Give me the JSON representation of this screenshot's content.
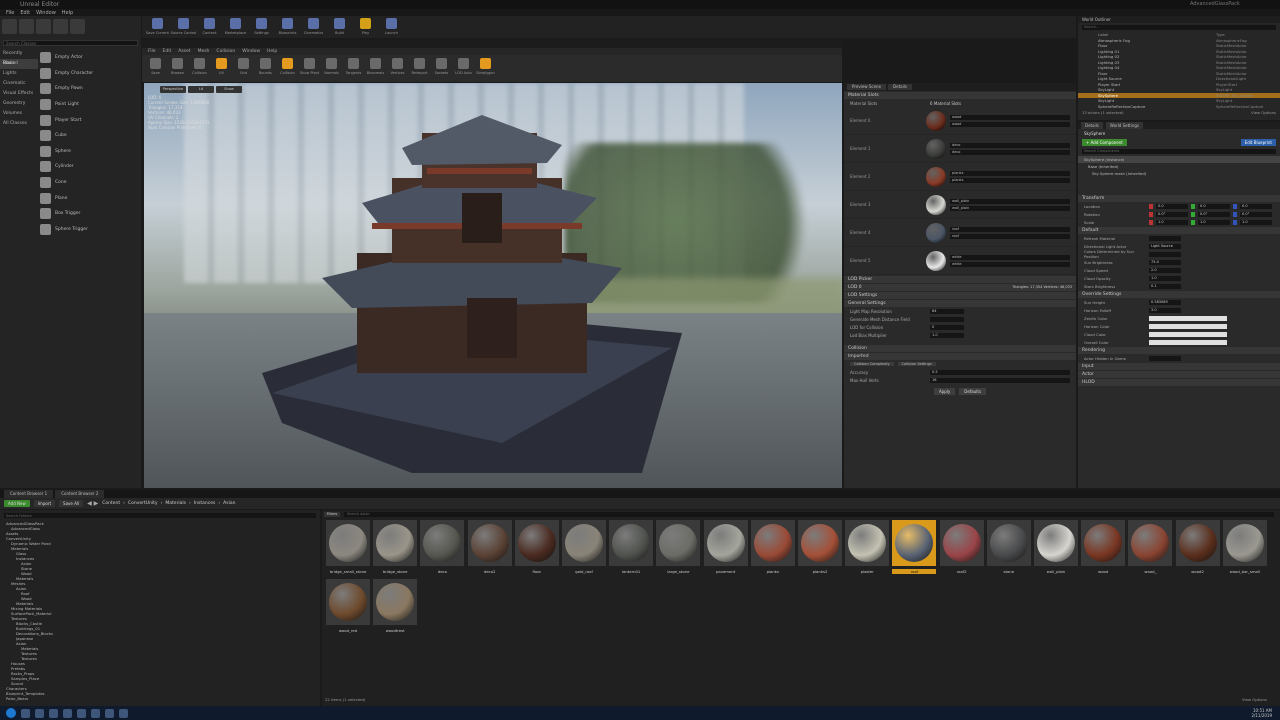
{
  "window": {
    "title": "Unreal Editor",
    "project": "AdvancedGlassPack"
  },
  "menu": [
    "File",
    "Edit",
    "Window",
    "Help"
  ],
  "main_toolbar": [
    "Save Current",
    "Source Control",
    "Content",
    "Marketplace",
    "Settings",
    "Blueprints",
    "Cinematics",
    "Build",
    "Play",
    "Launch"
  ],
  "modes": {
    "search_placeholder": "Search Classes",
    "categories": [
      "Recently Placed",
      "Basic",
      "Lights",
      "Cinematic",
      "Visual Effects",
      "Geometry",
      "Volumes",
      "All Classes"
    ],
    "selected_category": "Basic",
    "items": [
      "Empty Actor",
      "Empty Character",
      "Empty Pawn",
      "Point Light",
      "Player Start",
      "Cube",
      "Sphere",
      "Cylinder",
      "Cone",
      "Plane",
      "Box Trigger",
      "Sphere Trigger"
    ]
  },
  "viewport": {
    "menu": [
      "File",
      "Edit",
      "Asset",
      "Mesh",
      "Collision",
      "Window",
      "Help"
    ],
    "toolbar": [
      "Save",
      "Browse",
      "Collision",
      "UV",
      "Grid",
      "Bounds",
      "Collision",
      "Show Pivot",
      "Normals",
      "Tangents",
      "Binormals",
      "Vertices",
      "Reimport",
      "Sockets",
      "LOD Auto",
      "Simplygon"
    ],
    "buttons": [
      "Perspective",
      "Lit",
      "Show"
    ],
    "info": [
      "LOD: 0",
      "Current Screen Size: 1.000000",
      "Triangles: 17,354",
      "Vertices: 46,033",
      "UV Channels: 2",
      "Approx Size: 1526x1318x1571",
      "Num Collision Primitives: 0"
    ]
  },
  "details_mid": {
    "tabs": [
      "Preview Scene",
      "Details"
    ],
    "sections": {
      "material_slots": "Material Slots",
      "lod_picker": "LOD Picker",
      "lod0": "LOD 0",
      "lod_settings": "LOD Settings",
      "general_settings": "General Settings",
      "collision": "Collision",
      "imported": "Imported"
    },
    "material_slots_label": "Material Slots",
    "element_count": "6 Material Slots",
    "elements": [
      {
        "label": "Element 0",
        "mat": "wood",
        "slot": "wood",
        "color": "#6b2c1c"
      },
      {
        "label": "Element 1",
        "mat": "deco",
        "slot": "deco",
        "color": "#3b3d3a"
      },
      {
        "label": "Element 2",
        "mat": "planks",
        "slot": "planks",
        "color": "#8a3a26"
      },
      {
        "label": "Element 3",
        "mat": "wall_plain",
        "slot": "wall_plain",
        "color": "#d7d7d2"
      },
      {
        "label": "Element 4",
        "mat": "roof",
        "slot": "roof",
        "color": "#4a5565"
      },
      {
        "label": "Element 5",
        "mat": "white",
        "slot": "white",
        "color": "#e8e8e8"
      }
    ],
    "lod_stats": "Triangles: 17,354   Vertices: 46,033",
    "general": [
      {
        "k": "Light Map Resolution",
        "v": "64"
      },
      {
        "k": "Generate Mesh Distance Field",
        "v": ""
      },
      {
        "k": "LOD for Collision",
        "v": "0"
      },
      {
        "k": "Lod Bias Multiplier",
        "v": "1.0"
      }
    ],
    "collision_tabs": [
      "Collision Complexity",
      "Collision Settings"
    ],
    "collision_rows": [
      {
        "k": "Accuracy",
        "v": "0.5"
      },
      {
        "k": "Max Hull Verts",
        "v": "16"
      }
    ],
    "apply": "Apply",
    "defaults": "Defaults"
  },
  "outliner": {
    "tab": "World Outliner",
    "search_placeholder": "Search...",
    "columns": [
      "Label",
      "Type"
    ],
    "rows": [
      {
        "n": "Atmospheric Fog",
        "t": "AtmosphericFog"
      },
      {
        "n": "Floor",
        "t": "StaticMeshActor"
      },
      {
        "n": "Lighting 01",
        "t": "StaticMeshActor"
      },
      {
        "n": "Lighting 02",
        "t": "StaticMeshActor"
      },
      {
        "n": "Lighting 03",
        "t": "StaticMeshActor"
      },
      {
        "n": "Lighting 04",
        "t": "StaticMeshActor"
      },
      {
        "n": "Floor",
        "t": "StaticMeshActor"
      },
      {
        "n": "Light Source",
        "t": "DirectionalLight"
      },
      {
        "n": "Player Start",
        "t": "PlayerStart"
      },
      {
        "n": "SkyLight",
        "t": "SkyLight"
      },
      {
        "n": "SkySphere",
        "t": "Edit BP_Sky_Sphere"
      },
      {
        "n": "SkyLight",
        "t": "SkyLight"
      },
      {
        "n": "SphereReflectionCapture",
        "t": "SphereReflectionCapture"
      }
    ],
    "selected_index": 10,
    "count": "13 actors (1 selected)",
    "view_options": "View Options"
  },
  "rdetails": {
    "tabs": [
      "Details",
      "World Settings"
    ],
    "actor_name": "SkySphere",
    "add_component": "+ Add Component",
    "edit_blueprint": "Edit Blueprint",
    "search_placeholder": "Search Components",
    "components": [
      "SkySphere (Instance)",
      "Base (Inherited)",
      "Sky Sphere mesh (Inherited)"
    ],
    "sections": [
      "Transform",
      "Default",
      "Override Settings",
      "Rendering",
      "Input",
      "Actor",
      "HLOD"
    ],
    "transform": [
      {
        "k": "Location",
        "v": [
          "0.0",
          "0.0",
          "0.0"
        ]
      },
      {
        "k": "Rotation",
        "v": [
          "0.0°",
          "0.0°",
          "0.0°"
        ]
      },
      {
        "k": "Scale",
        "v": [
          "1.0",
          "1.0",
          "1.0"
        ]
      }
    ],
    "default": [
      {
        "k": "Refresh Material",
        "v": ""
      },
      {
        "k": "Directional Light Actor",
        "v": "Light Source"
      },
      {
        "k": "Colors Determined by Sun Position",
        "v": ""
      },
      {
        "k": "Sun Brightness",
        "v": "75.0"
      },
      {
        "k": "Cloud Speed",
        "v": "2.0"
      },
      {
        "k": "Cloud Opacity",
        "v": "1.0"
      },
      {
        "k": "Stars Brightness",
        "v": "0.1"
      }
    ],
    "override": [
      {
        "k": "Sun Height",
        "v": "0.583089"
      },
      {
        "k": "Horizon Falloff",
        "v": "3.0"
      },
      {
        "k": "Zenith Color",
        "v": ""
      },
      {
        "k": "Horizon Color",
        "v": ""
      },
      {
        "k": "Cloud Color",
        "v": ""
      },
      {
        "k": "Overall Color",
        "v": ""
      }
    ],
    "rendering": [
      {
        "k": "Actor Hidden In Game",
        "v": ""
      }
    ]
  },
  "content_browser": {
    "tabs": [
      "Content Browser 1",
      "Content Browser 2"
    ],
    "add_new": "Add New",
    "import": "Import",
    "save_all": "Save All",
    "breadcrumb": [
      "Content",
      "ConvertUnity",
      "Materials",
      "Instances",
      "Asian"
    ],
    "search_folders": "Search Folders",
    "filters": "Filters",
    "search_assets": "Search Asian",
    "tree": [
      "AdvancedGlassPack",
      "AdvancedGlass",
      "Assets",
      "ConvertUnity",
      "Dynamic Water Pond",
      "Materials",
      "Glass",
      "Instances",
      "Asian",
      "Stone",
      "Wood",
      "Materials",
      "Meshes",
      "Asian",
      "Roof",
      "Wood",
      "Materials",
      "Mixing Materials",
      "SurfacePack_Material",
      "Textures",
      "Blocks_Castle",
      "Buildings_01",
      "Decorations_Blocks",
      "Japanese",
      "Asian",
      "Materials",
      "Textures",
      "Textures",
      "Houses",
      "Prefabs",
      "Rocks_Props",
      "Samples_Place",
      "Sound",
      "Characters",
      "Blueprint_Templates",
      "Polar_Bears"
    ],
    "assets": [
      {
        "n": "bridge_small_stone",
        "c": "#8c8880"
      },
      {
        "n": "bridge_stone",
        "c": "#9a958a"
      },
      {
        "n": "deco",
        "c": "#55574f"
      },
      {
        "n": "deco2",
        "c": "#5a4134"
      },
      {
        "n": "floor",
        "c": "#4a2a20"
      },
      {
        "n": "gold_roof",
        "c": "#8a8478"
      },
      {
        "n": "lantern01",
        "c": "#4f524d"
      },
      {
        "n": "large_stone",
        "c": "#6c6c66"
      },
      {
        "n": "pavement",
        "c": "#a4a59c"
      },
      {
        "n": "planks",
        "c": "#9a4a36"
      },
      {
        "n": "planks2",
        "c": "#a55038"
      },
      {
        "n": "plaster",
        "c": "#c4c2b2"
      },
      {
        "n": "roof",
        "c": "#5a6475"
      },
      {
        "n": "roof2",
        "c": "#9a4448"
      },
      {
        "n": "stone",
        "c": "#48494a"
      },
      {
        "n": "wall_plain",
        "c": "#d7d5cf"
      },
      {
        "n": "wood",
        "c": "#7a3622"
      },
      {
        "n": "wood_",
        "c": "#8a4432"
      },
      {
        "n": "wood2",
        "c": "#5a2e1c"
      },
      {
        "n": "wood_bar_small",
        "c": "#9a9890"
      },
      {
        "n": "wood_red",
        "c": "#6e4a2c"
      },
      {
        "n": "woodtrest",
        "c": "#8a7860"
      }
    ],
    "selected": "roof",
    "count": "22 items (1 selected)",
    "view_options": "View Options"
  },
  "taskbar": {
    "time": "10:51 AM",
    "date": "2/11/2019"
  }
}
